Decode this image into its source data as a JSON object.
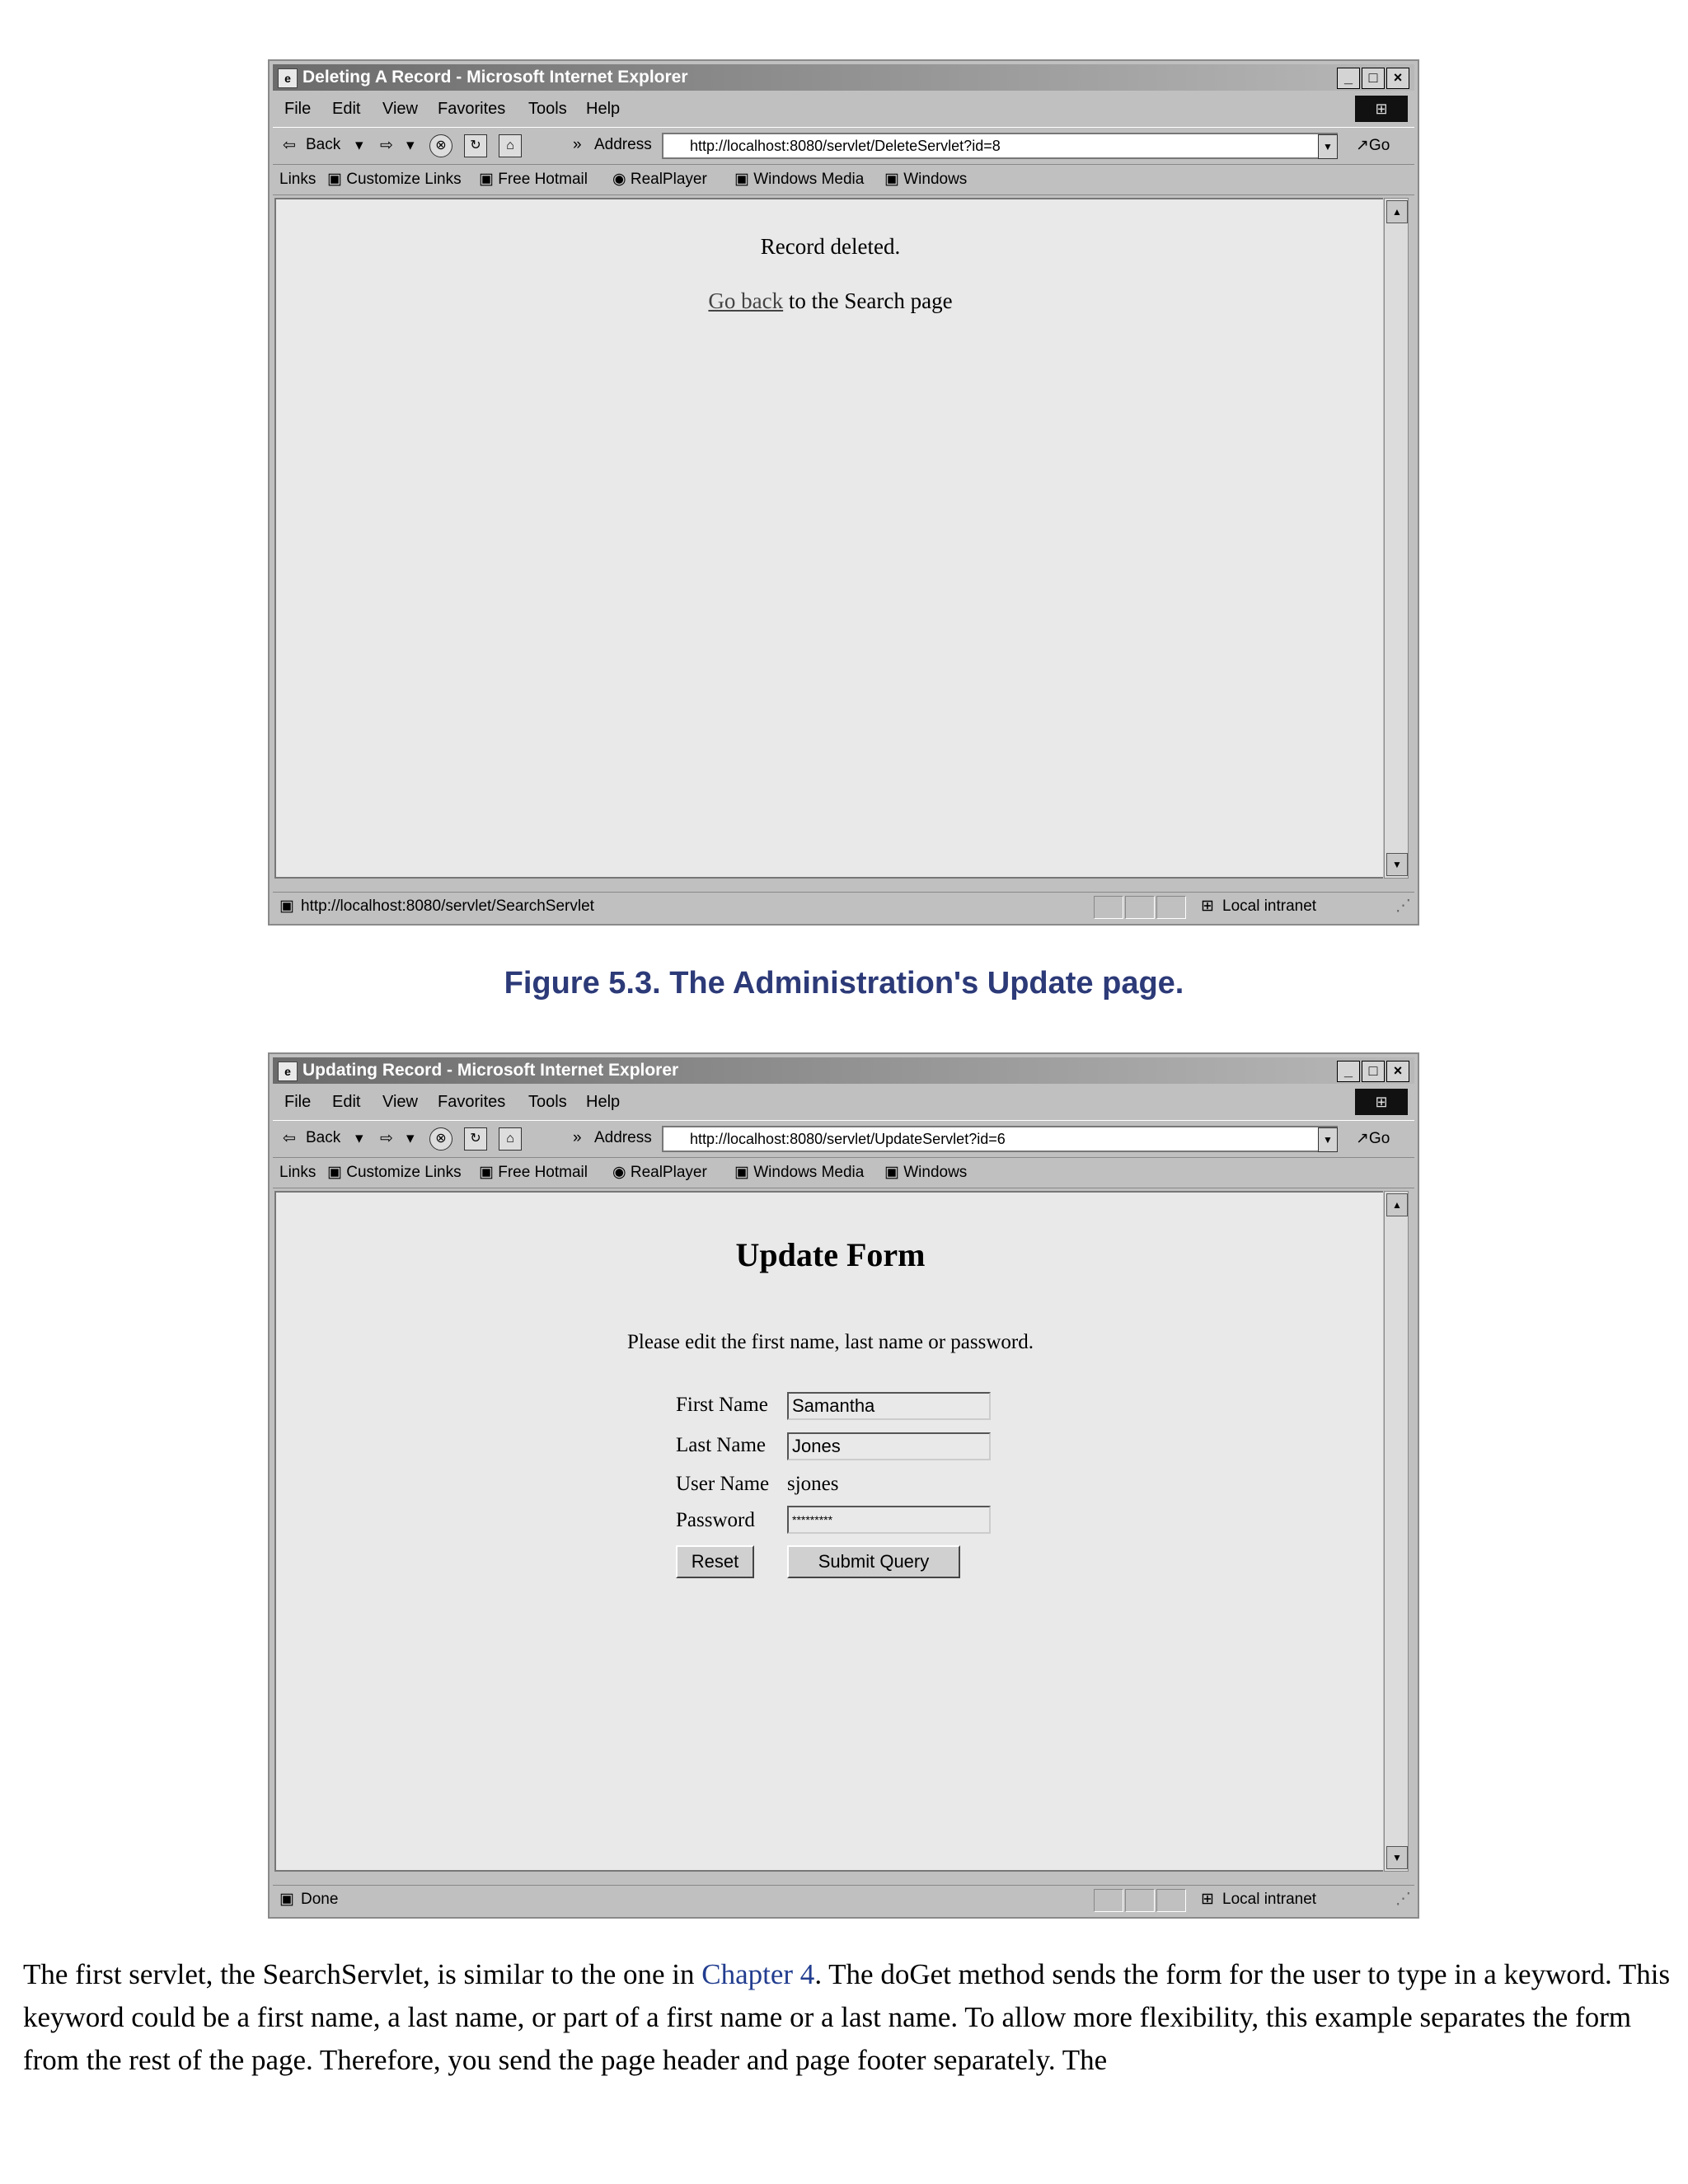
{
  "window1": {
    "title": "Deleting A Record - Microsoft Internet Explorer",
    "menu": [
      "File",
      "Edit",
      "View",
      "Favorites",
      "Tools",
      "Help"
    ],
    "toolbar": {
      "back": "Back",
      "address_label": "Address",
      "go": "Go"
    },
    "address": "http://localhost:8080/servlet/DeleteServlet?id=8",
    "links": {
      "label": "Links",
      "items": [
        "Customize Links",
        "Free Hotmail",
        "RealPlayer",
        "Windows Media",
        "Windows"
      ]
    },
    "content": {
      "message": "Record deleted.",
      "link_text": "Go back",
      "link_suffix": " to the Search page"
    },
    "status": {
      "text": "http://localhost:8080/servlet/SearchServlet",
      "zone": "Local intranet"
    }
  },
  "caption": "Figure 5.3. The Administration's Update page.",
  "window2": {
    "title": "Updating Record - Microsoft Internet Explorer",
    "menu": [
      "File",
      "Edit",
      "View",
      "Favorites",
      "Tools",
      "Help"
    ],
    "toolbar": {
      "back": "Back",
      "address_label": "Address",
      "go": "Go"
    },
    "address": "http://localhost:8080/servlet/UpdateServlet?id=6",
    "links": {
      "label": "Links",
      "items": [
        "Customize Links",
        "Free Hotmail",
        "RealPlayer",
        "Windows Media",
        "Windows"
      ]
    },
    "content": {
      "heading": "Update Form",
      "instruction": "Please edit the first name, last name or password.",
      "first_name_label": "First Name",
      "first_name_value": "Samantha",
      "last_name_label": "Last Name",
      "last_name_value": "Jones",
      "user_name_label": "User Name",
      "user_name_value": "sjones",
      "password_label": "Password",
      "password_value": "*********",
      "reset_label": "Reset",
      "submit_label": "Submit Query"
    },
    "status": {
      "text": "Done",
      "zone": "Local intranet"
    }
  },
  "body_text": {
    "part1": "The first servlet, the SearchServlet, is similar to the one in ",
    "link": "Chapter 4",
    "part2": ". The doGet method sends the form for the user to type in a keyword. This keyword could be a first name, a last name, or part of a first name or a last name. To allow more flexibility, this example separates the form from the rest of the page. Therefore, you send the page header and page footer separately. The"
  }
}
